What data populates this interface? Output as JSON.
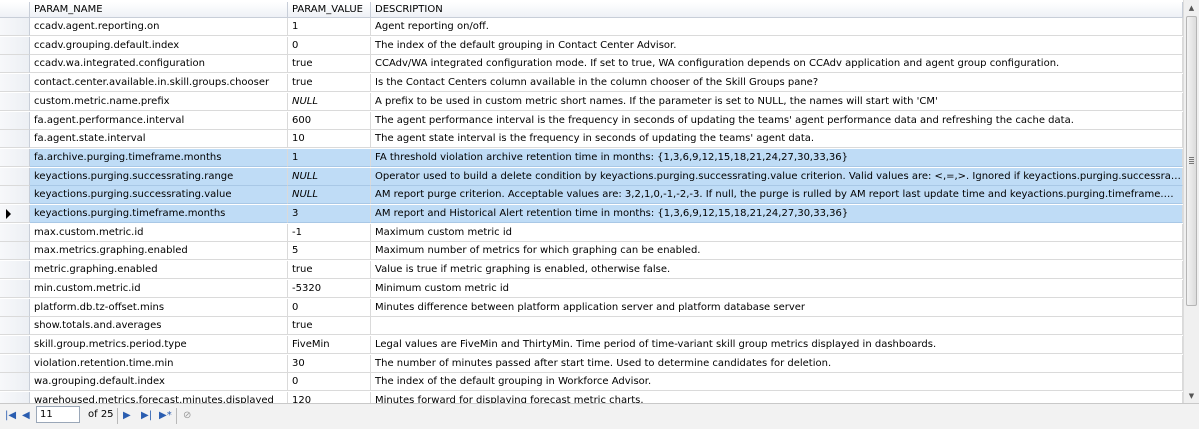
{
  "grid": {
    "columns": [
      "PARAM_NAME",
      "PARAM_VALUE",
      "DESCRIPTION"
    ],
    "rows": [
      {
        "name": "ccadv.agent.reporting.on",
        "value": "1",
        "desc": "Agent reporting on/off.",
        "selected": false,
        "current": false
      },
      {
        "name": "ccadv.grouping.default.index",
        "value": "0",
        "desc": " The index of the default grouping in Contact Center Advisor.",
        "selected": false,
        "current": false
      },
      {
        "name": "ccadv.wa.integrated.configuration",
        "value": "true",
        "desc": " CCAdv/WA integrated configuration mode. If set to true, WA configuration depends on CCAdv application and agent group configuration.",
        "selected": false,
        "current": false
      },
      {
        "name": "contact.center.available.in.skill.groups.chooser",
        "value": "true",
        "desc": "Is the Contact Centers column available in the column chooser of the Skill Groups pane?",
        "selected": false,
        "current": false
      },
      {
        "name": "custom.metric.name.prefix",
        "value": "NULL",
        "desc": "A prefix to be used in custom metric short names. If the parameter is set to NULL, the names will start with 'CM'",
        "selected": false,
        "current": false
      },
      {
        "name": "fa.agent.performance.interval",
        "value": "600",
        "desc": "The agent performance interval is the frequency in seconds of updating the teams' agent performance data and refreshing the cache data.",
        "selected": false,
        "current": false
      },
      {
        "name": "fa.agent.state.interval",
        "value": "10",
        "desc": "The agent state interval is the frequency in seconds of updating the teams' agent data.",
        "selected": false,
        "current": false
      },
      {
        "name": "fa.archive.purging.timeframe.months",
        "value": "1",
        "desc": "FA threshold violation archive retention time in months: {1,3,6,9,12,15,18,21,24,27,30,33,36}",
        "selected": true,
        "current": false
      },
      {
        "name": "keyactions.purging.successrating.range",
        "value": "NULL",
        "desc": "Operator used to build a delete condition by keyactions.purging.successrating.value criterion. Valid values are: <,=,>. Ignored if keyactions.purging.successrating.value is not defin...",
        "selected": true,
        "current": false
      },
      {
        "name": "keyactions.purging.successrating.value",
        "value": "NULL",
        "desc": "AM report purge criterion. Acceptable values are: 3,2,1,0,-1,-2,-3. If null, the purge is rulled by AM report last update time and keyactions.purging.timeframe.months parameter.",
        "selected": true,
        "current": false
      },
      {
        "name": "keyactions.purging.timeframe.months",
        "value": "3",
        "desc": "AM report and Historical Alert retention time in months: {1,3,6,9,12,15,18,21,24,27,30,33,36}",
        "selected": true,
        "current": true
      },
      {
        "name": "max.custom.metric.id",
        "value": "-1",
        "desc": "Maximum custom metric id",
        "selected": false,
        "current": false
      },
      {
        "name": "max.metrics.graphing.enabled",
        "value": "5",
        "desc": "Maximum number of metrics for which graphing can be enabled.",
        "selected": false,
        "current": false
      },
      {
        "name": "metric.graphing.enabled",
        "value": "true",
        "desc": "Value is true if metric graphing is enabled, otherwise false.",
        "selected": false,
        "current": false
      },
      {
        "name": "min.custom.metric.id",
        "value": "-5320",
        "desc": "Minimum custom metric id",
        "selected": false,
        "current": false
      },
      {
        "name": "platform.db.tz-offset.mins",
        "value": "0",
        "desc": "Minutes difference between platform application server and platform database server",
        "selected": false,
        "current": false
      },
      {
        "name": "show.totals.and.averages",
        "value": "true",
        "desc": "",
        "selected": false,
        "current": false
      },
      {
        "name": "skill.group.metrics.period.type",
        "value": "FiveMin",
        "desc": "Legal values are FiveMin and ThirtyMin. Time period of time-variant skill group metrics displayed in dashboards.",
        "selected": false,
        "current": false
      },
      {
        "name": "violation.retention.time.min",
        "value": "30",
        "desc": "The number of minutes passed after start time. Used to determine candidates for deletion.",
        "selected": false,
        "current": false
      },
      {
        "name": "wa.grouping.default.index",
        "value": "0",
        "desc": " The index of the default grouping in Workforce Advisor.",
        "selected": false,
        "current": false
      },
      {
        "name": "warehoused.metrics.forecast.minutes.displayed",
        "value": "120",
        "desc": "Minutes forward for displaying forecast metric charts.",
        "selected": false,
        "current": false
      }
    ]
  },
  "navigator": {
    "first_icon": "first-record-icon",
    "prev_icon": "previous-record-icon",
    "current": "11",
    "of_total": "of 25",
    "next_icon": "next-record-icon",
    "last_icon": "last-record-icon",
    "new_icon": "new-record-icon",
    "cancel_icon": "cancel-icon"
  },
  "colors": {
    "selection": "#bfdcf6",
    "nav_accent": "#2a5db0"
  }
}
